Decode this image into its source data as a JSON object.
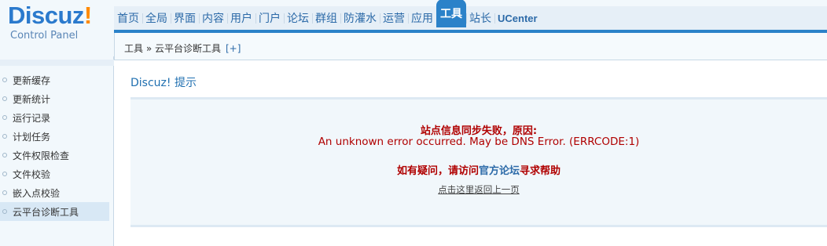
{
  "logo": {
    "brand": "Discuz",
    "bang": "!",
    "sub": "Control Panel"
  },
  "nav": {
    "items": [
      {
        "label": "首页"
      },
      {
        "label": "全局"
      },
      {
        "label": "界面"
      },
      {
        "label": "内容"
      },
      {
        "label": "用户"
      },
      {
        "label": "门户"
      },
      {
        "label": "论坛"
      },
      {
        "label": "群组"
      },
      {
        "label": "防灌水"
      },
      {
        "label": "运营"
      },
      {
        "label": "应用"
      },
      {
        "label": "工具",
        "active": true
      },
      {
        "label": "站长"
      },
      {
        "label": "UCenter"
      }
    ]
  },
  "breadcrumb": {
    "text": "工具 » 云平台诊断工具",
    "plus": "[+]"
  },
  "sidebar": {
    "items": [
      {
        "label": "更新缓存"
      },
      {
        "label": "更新统计"
      },
      {
        "label": "运行记录"
      },
      {
        "label": "计划任务"
      },
      {
        "label": "文件权限检查"
      },
      {
        "label": "文件校验"
      },
      {
        "label": "嵌入点校验"
      },
      {
        "label": "云平台诊断工具",
        "active": true
      }
    ]
  },
  "content": {
    "title": "Discuz! 提示",
    "line1": "站点信息同步失败，原因:",
    "line2": "An unknown error occurred. May be DNS Error. (ERRCODE:1)",
    "line3_pre": "如有疑问，请访问",
    "line3_link": "官方论坛",
    "line3_post": "寻求帮助",
    "back_link": "点击这里返回上一页"
  },
  "colors": {
    "accent": "#2b82c9",
    "error": "#b00000",
    "link": "#2c6aa8"
  }
}
